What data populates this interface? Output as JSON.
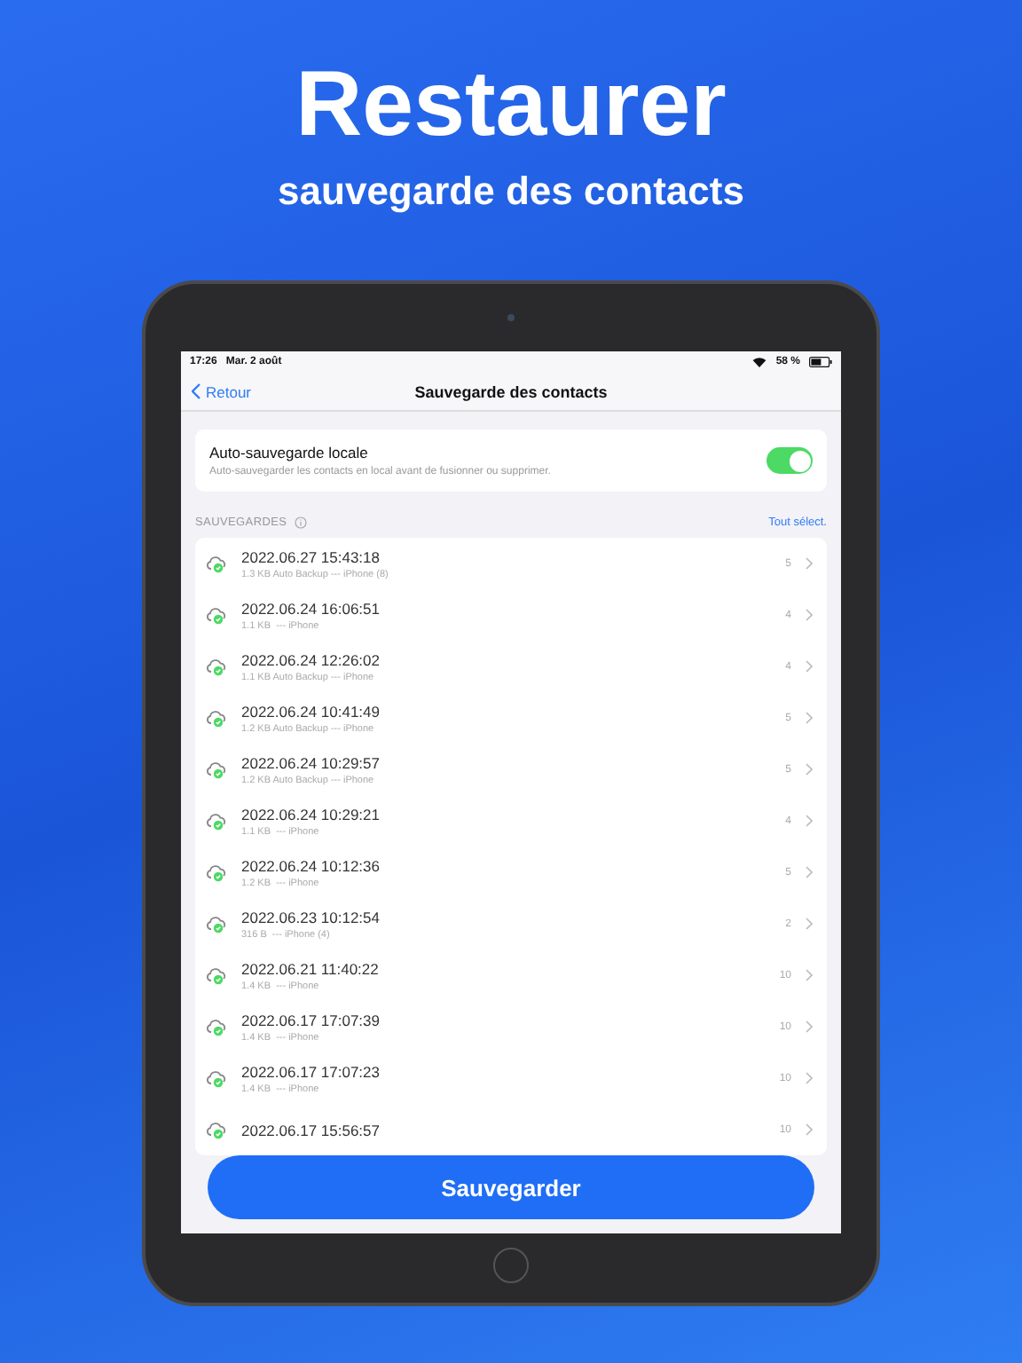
{
  "headline": "Restaurer",
  "subheadline": "sauvegarde des contacts",
  "status_bar": {
    "time": "17:26",
    "date": "Mar. 2 août",
    "battery": "58 %"
  },
  "nav": {
    "back": "Retour",
    "title": "Sauvegarde des contacts"
  },
  "auto_backup": {
    "title": "Auto-sauvegarde locale",
    "description": "Auto-sauvegarder les contacts en local avant de fusionner ou supprimer.",
    "on": true
  },
  "section": {
    "title": "SAUVEGARDES",
    "action": "Tout sélect."
  },
  "backups": [
    {
      "date": "2022.06.27 15:43:18",
      "details": "1.3 KB Auto Backup --- iPhone (8)",
      "count": "5"
    },
    {
      "date": "2022.06.24 16:06:51",
      "details": "1.1 KB  --- iPhone",
      "count": "4"
    },
    {
      "date": "2022.06.24 12:26:02",
      "details": "1.1 KB Auto Backup --- iPhone",
      "count": "4"
    },
    {
      "date": "2022.06.24 10:41:49",
      "details": "1.2 KB Auto Backup --- iPhone",
      "count": "5"
    },
    {
      "date": "2022.06.24 10:29:57",
      "details": "1.2 KB Auto Backup --- iPhone",
      "count": "5"
    },
    {
      "date": "2022.06.24 10:29:21",
      "details": "1.1 KB  --- iPhone",
      "count": "4"
    },
    {
      "date": "2022.06.24 10:12:36",
      "details": "1.2 KB  --- iPhone",
      "count": "5"
    },
    {
      "date": "2022.06.23 10:12:54",
      "details": "316 B  --- iPhone (4)",
      "count": "2"
    },
    {
      "date": "2022.06.21 11:40:22",
      "details": "1.4 KB  --- iPhone",
      "count": "10"
    },
    {
      "date": "2022.06.17 17:07:39",
      "details": "1.4 KB  --- iPhone",
      "count": "10"
    },
    {
      "date": "2022.06.17 17:07:23",
      "details": "1.4 KB  --- iPhone",
      "count": "10"
    },
    {
      "date": "2022.06.17 15:56:57",
      "count": "10"
    }
  ],
  "save_button": "Sauvegarder"
}
